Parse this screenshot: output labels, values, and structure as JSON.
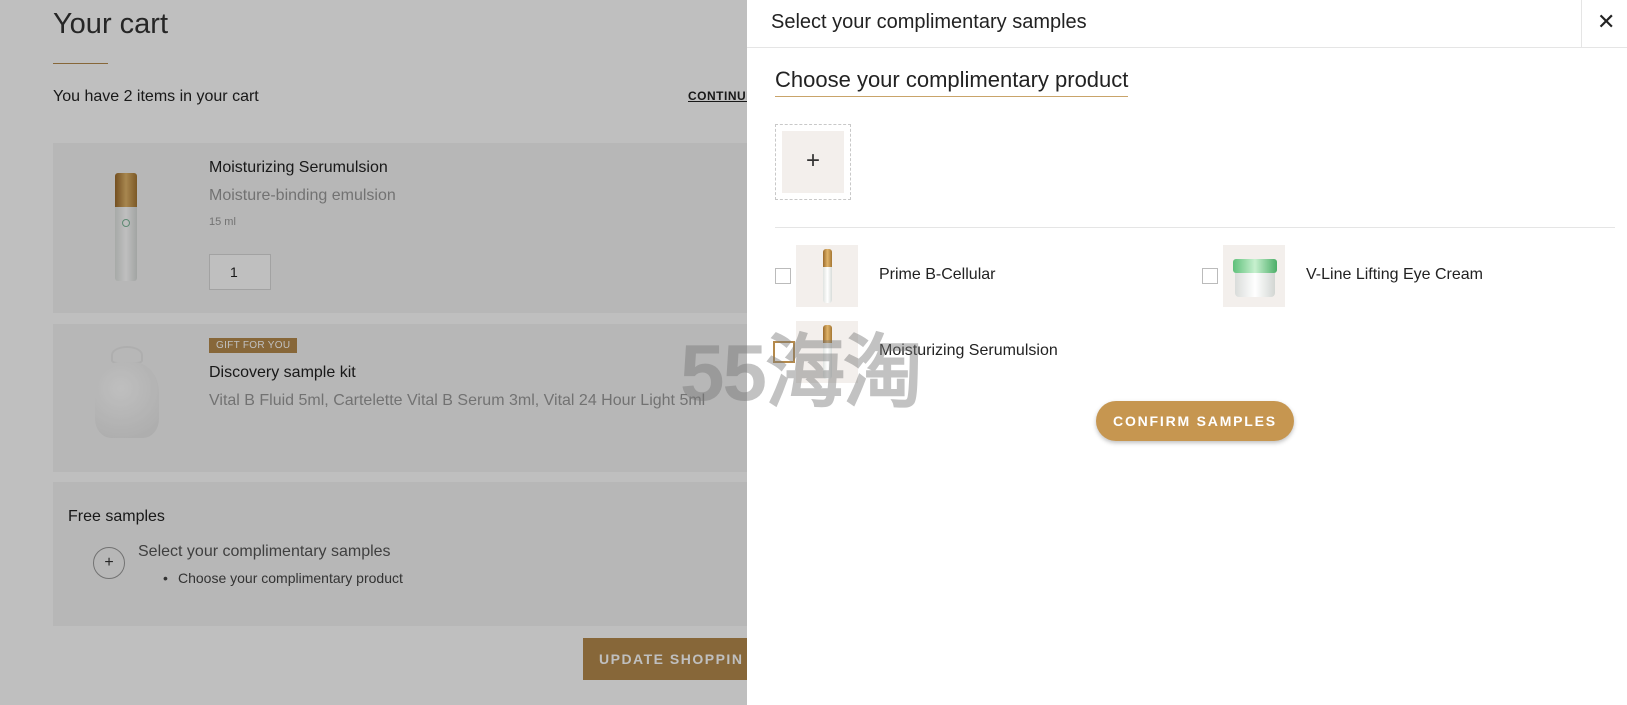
{
  "cart": {
    "title": "Your cart",
    "items_count": "You have 2 items in your cart",
    "continue_link": "CONTINUE",
    "items": [
      {
        "name": "Moisturizing Serumulsion",
        "subtitle": "Moisture-binding emulsion",
        "size": "15 ml",
        "quantity": "1"
      },
      {
        "badge": "GIFT FOR YOU",
        "name": "Discovery sample kit",
        "subtitle": "Vital B Fluid 5ml, Cartelette Vital B Serum 3ml, Vital 24 Hour Light 5ml"
      }
    ],
    "free_samples": {
      "title": "Free samples",
      "plus_label": "+",
      "link": "Select your complimentary samples",
      "bullet": "Choose your complimentary product"
    },
    "update_button": "UPDATE SHOPPIN"
  },
  "drawer": {
    "title": "Select your complimentary samples",
    "close_label": "✕",
    "choose_title": "Choose your complimentary product",
    "slot_plus": "+",
    "options": [
      {
        "label": "Prime B-Cellular",
        "icon": "bottle-icon"
      },
      {
        "label": "V-Line Lifting Eye Cream",
        "icon": "jar-icon"
      },
      {
        "label": "Moisturizing Serumulsion",
        "icon": "bottle-icon"
      }
    ],
    "confirm_button": "CONFIRM SAMPLES"
  },
  "watermark": "55海淘",
  "colors": {
    "accent": "#b58a4c",
    "confirm": "#c69650"
  }
}
